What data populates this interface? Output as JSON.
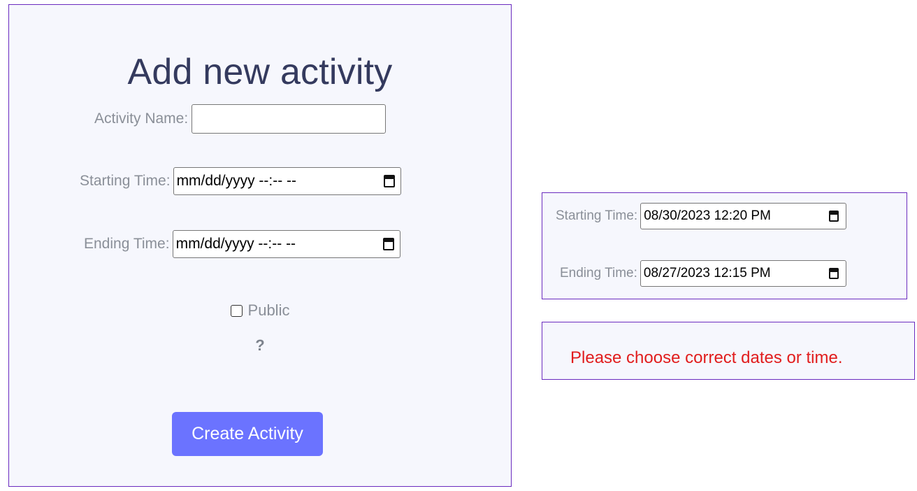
{
  "form": {
    "title": "Add new activity",
    "activity_name_label": "Activity Name:",
    "activity_name_value": "",
    "starting_time_label": "Starting Time:",
    "starting_time_value": "mm/dd/yyyy --:-- --",
    "ending_time_label": "Ending Time:",
    "ending_time_value": "mm/dd/yyyy --:-- --",
    "public_label": "Public",
    "public_checked": false,
    "help_text": "?",
    "create_button_label": "Create Activity"
  },
  "example_dates": {
    "starting_time_label": "Starting Time:",
    "starting_time_value": "08/30/2023 12:20 PM",
    "ending_time_label": "Ending Time:",
    "ending_time_value": "08/27/2023 12:15 PM"
  },
  "error": {
    "message": "Please choose correct dates or time."
  },
  "colors": {
    "panel_bg": "#f6f7fd",
    "panel_border": "#6a2bbf",
    "title": "#343a5e",
    "label": "#8a8f98",
    "button_bg": "#6b73ff",
    "error": "#e11d1d"
  },
  "icons": {
    "calendar": "calendar-icon",
    "checkbox": "checkbox"
  }
}
